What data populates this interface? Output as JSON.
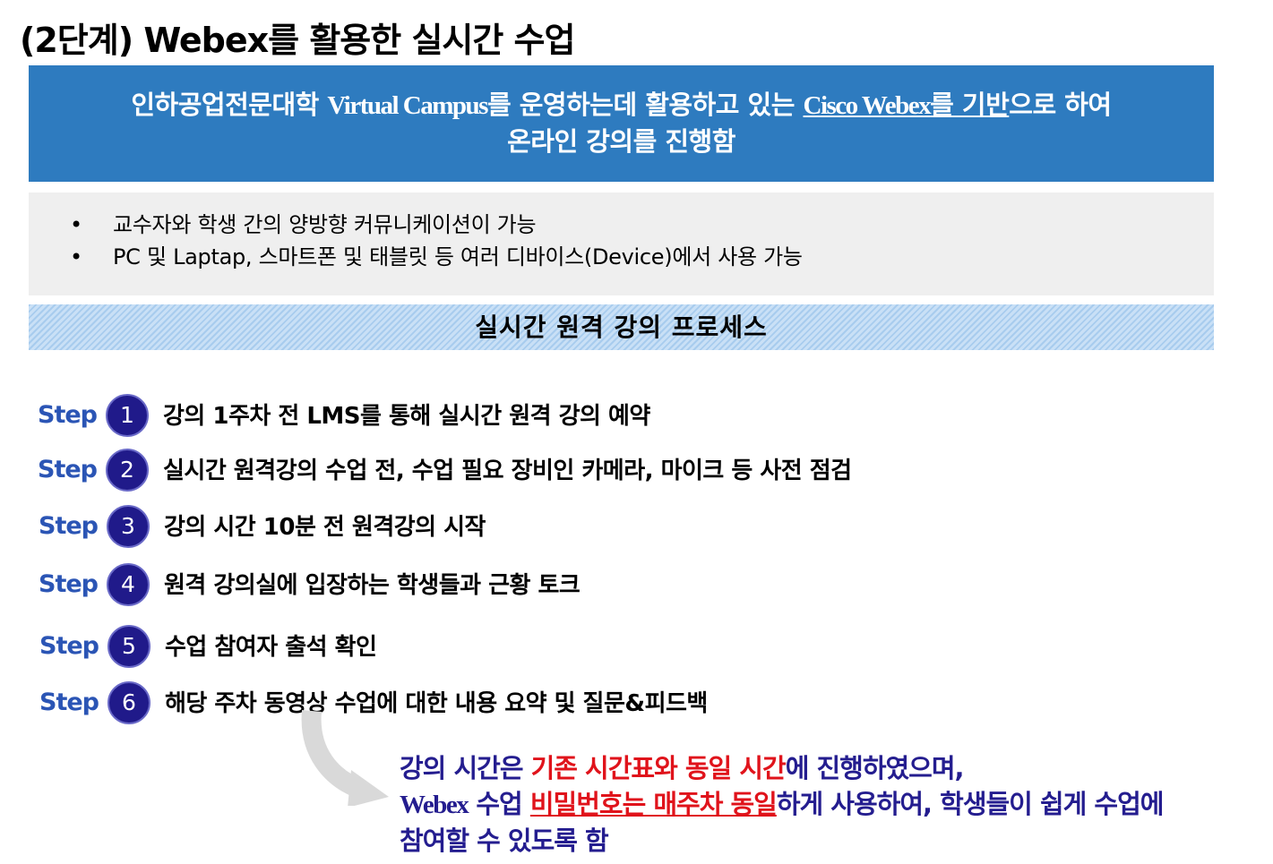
{
  "title": "(2단계) Webex를 활용한 실시간 수업",
  "banner": {
    "line1_a": "인하공업전문대학 ",
    "line1_b": "Virtual Campus",
    "line1_c": "를 운영하는데 활용하고 있는 ",
    "line1_d": "Cisco Webex",
    "line1_e": "를 기반",
    "line1_f": "으로 하여",
    "line2": "온라인 강의를 진행함",
    "bg_color": "#2e7bbf"
  },
  "bullets": [
    {
      "dot": "•",
      "text": "교수자와 학생 간의 양방향 커뮤니케이션이 가능"
    },
    {
      "dot": "•",
      "text": "PC 및 Laptap, 스마트폰 및 태블릿 등 여러 디바이스(Device)에서 사용 가능"
    }
  ],
  "process_title": "실시간 원격 강의 프로세스",
  "steps": [
    {
      "label": "Step",
      "num": "1",
      "text": "강의 1주차 전 LMS를 통해 실시간 원격 강의 예약"
    },
    {
      "label": "Step",
      "num": "2",
      "text": "실시간 원격강의 수업 전, 수업 필요 장비인 카메라, 마이크 등 사전 점검"
    },
    {
      "label": "Step",
      "num": "3",
      "text": "강의 시간 10분 전 원격강의 시작"
    },
    {
      "label": "Step",
      "num": "4",
      "text": "원격 강의실에 입장하는 학생들과 근황 토크"
    },
    {
      "label": "Step",
      "num": "5",
      "text": "수업 참여자 출석 확인"
    },
    {
      "label": "Step",
      "num": "6",
      "text": "해당 주차 동영상 수업에 대한 내용 요약 및 질문&피드백"
    }
  ],
  "note": {
    "l1_a": "강의 시간은 ",
    "l1_b": "기존 시간표와 동일 시간",
    "l1_c": "에 진행하였으며,",
    "l2_a": "Webex",
    "l2_b": " 수업 ",
    "l2_c": "비밀번호는 매주차 동일",
    "l2_d": "하게 사용하여, 학생들이 쉽게 수업에",
    "l3": "참여할 수 있도록 함",
    "text_color": "#241d8f",
    "highlight_color": "#e0131b"
  }
}
